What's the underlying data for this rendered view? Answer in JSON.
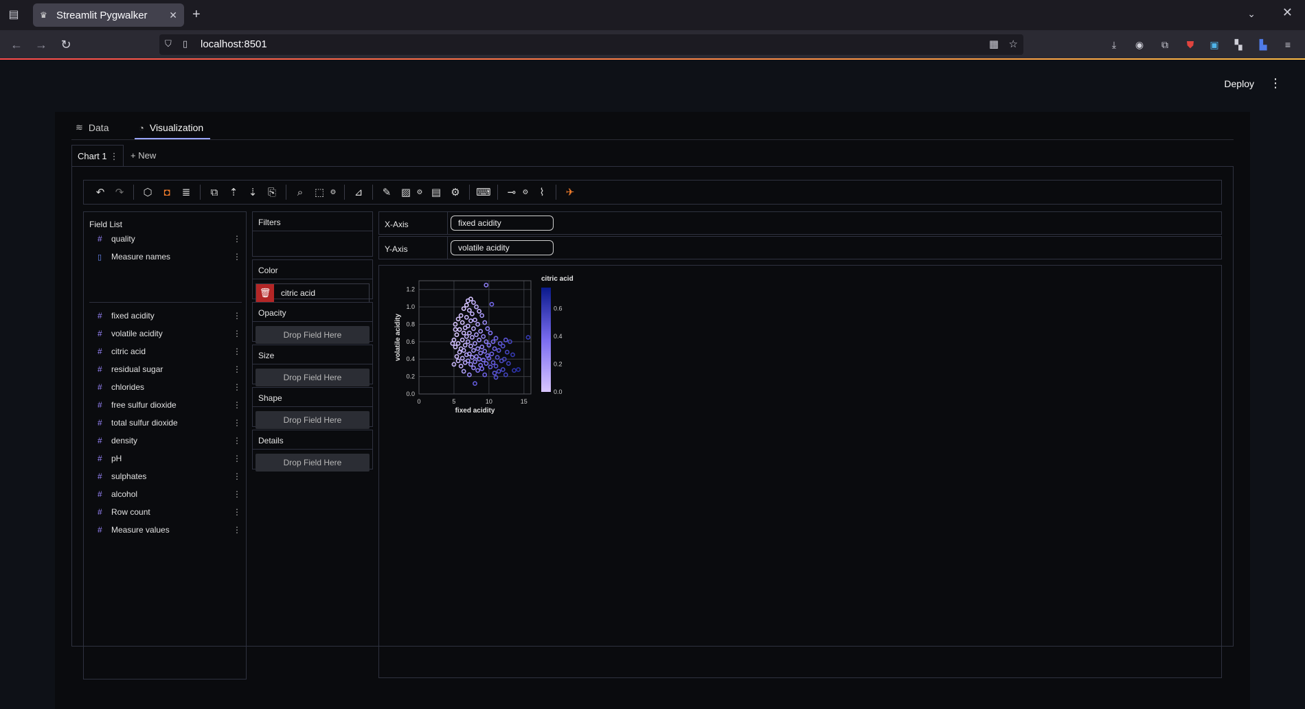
{
  "browser": {
    "tab_title": "Streamlit Pygwalker",
    "url": "localhost:8501"
  },
  "app": {
    "deploy_label": "Deploy",
    "tabs": [
      {
        "label": "Data",
        "icon": "database-icon"
      },
      {
        "label": "Visualization",
        "icon": "chart-icon"
      }
    ],
    "chart_tab": "Chart 1",
    "new_chart": "+ New"
  },
  "field_list": {
    "title": "Field List",
    "dimensions": [
      {
        "label": "quality",
        "type": "measure"
      },
      {
        "label": "Measure names",
        "type": "dimension"
      }
    ],
    "measures": [
      "fixed acidity",
      "volatile acidity",
      "citric acid",
      "residual sugar",
      "chlorides",
      "free sulfur dioxide",
      "total sulfur dioxide",
      "density",
      "pH",
      "sulphates",
      "alcohol",
      "Row count",
      "Measure values"
    ]
  },
  "encodings": {
    "filters": "Filters",
    "color": "Color",
    "color_field": "citric acid",
    "opacity": "Opacity",
    "size": "Size",
    "shape": "Shape",
    "details": "Details",
    "drop_placeholder": "Drop Field Here"
  },
  "axes": {
    "x_label": "X-Axis",
    "x_field": "fixed acidity",
    "y_label": "Y-Axis",
    "y_field": "volatile acidity"
  },
  "colors": {
    "accent": "#9aa6ff",
    "delete": "#b32626",
    "legend_high": "#0a1a8c",
    "legend_low": "#d9c6ff"
  },
  "chart_data": {
    "type": "scatter",
    "xlabel": "fixed acidity",
    "ylabel": "volatile acidity",
    "legend_title": "citric acid",
    "xlim": [
      0,
      16
    ],
    "ylim": [
      0,
      1.3
    ],
    "x_ticks": [
      "0",
      "5",
      "10",
      "15"
    ],
    "y_ticks": [
      "0.0",
      "0.2",
      "0.4",
      "0.6",
      "0.8",
      "1.0",
      "1.2"
    ],
    "legend_ticks": [
      "0.6",
      "0.4",
      "0.2",
      "0.0"
    ],
    "legend_range": [
      0,
      0.75
    ],
    "points": [
      [
        9.6,
        1.25,
        0.3
      ],
      [
        10.4,
        1.03,
        0.4
      ],
      [
        15.6,
        0.65,
        0.6
      ],
      [
        7.4,
        1.09,
        0.0
      ],
      [
        7.0,
        1.07,
        0.05
      ],
      [
        7.8,
        1.05,
        0.1
      ],
      [
        6.8,
        1.02,
        0.0
      ],
      [
        8.2,
        1.0,
        0.1
      ],
      [
        6.4,
        0.98,
        0.0
      ],
      [
        7.2,
        0.96,
        0.05
      ],
      [
        8.6,
        0.95,
        0.1
      ],
      [
        7.6,
        0.92,
        0.08
      ],
      [
        6.0,
        0.9,
        0.02
      ],
      [
        9.0,
        0.9,
        0.2
      ],
      [
        6.8,
        0.88,
        0.05
      ],
      [
        5.6,
        0.86,
        0.0
      ],
      [
        8.0,
        0.85,
        0.12
      ],
      [
        7.4,
        0.84,
        0.1
      ],
      [
        6.2,
        0.82,
        0.02
      ],
      [
        9.4,
        0.82,
        0.25
      ],
      [
        5.2,
        0.8,
        0.0
      ],
      [
        8.4,
        0.8,
        0.15
      ],
      [
        7.0,
        0.78,
        0.08
      ],
      [
        6.6,
        0.76,
        0.05
      ],
      [
        7.8,
        0.75,
        0.12
      ],
      [
        9.8,
        0.75,
        0.3
      ],
      [
        5.8,
        0.74,
        0.02
      ],
      [
        8.8,
        0.72,
        0.2
      ],
      [
        6.4,
        0.7,
        0.05
      ],
      [
        7.2,
        0.7,
        0.1
      ],
      [
        10.2,
        0.7,
        0.35
      ],
      [
        5.4,
        0.68,
        0.0
      ],
      [
        8.2,
        0.68,
        0.18
      ],
      [
        6.8,
        0.66,
        0.08
      ],
      [
        9.2,
        0.66,
        0.28
      ],
      [
        7.6,
        0.65,
        0.15
      ],
      [
        11.0,
        0.64,
        0.42
      ],
      [
        12.4,
        0.62,
        0.48
      ],
      [
        5.0,
        0.62,
        0.02
      ],
      [
        6.2,
        0.62,
        0.05
      ],
      [
        8.6,
        0.62,
        0.22
      ],
      [
        10.6,
        0.6,
        0.38
      ],
      [
        7.0,
        0.6,
        0.12
      ],
      [
        13.0,
        0.6,
        0.55
      ],
      [
        9.6,
        0.6,
        0.3
      ],
      [
        5.6,
        0.58,
        0.04
      ],
      [
        8.0,
        0.58,
        0.2
      ],
      [
        11.6,
        0.58,
        0.45
      ],
      [
        6.6,
        0.56,
        0.08
      ],
      [
        10.0,
        0.56,
        0.35
      ],
      [
        7.4,
        0.55,
        0.15
      ],
      [
        12.0,
        0.55,
        0.5
      ],
      [
        9.0,
        0.54,
        0.28
      ],
      [
        5.2,
        0.54,
        0.02
      ],
      [
        8.4,
        0.52,
        0.25
      ],
      [
        6.0,
        0.52,
        0.05
      ],
      [
        10.8,
        0.52,
        0.42
      ],
      [
        7.8,
        0.5,
        0.2
      ],
      [
        11.4,
        0.5,
        0.48
      ],
      [
        6.4,
        0.5,
        0.1
      ],
      [
        9.4,
        0.49,
        0.32
      ],
      [
        12.6,
        0.48,
        0.55
      ],
      [
        5.8,
        0.48,
        0.06
      ],
      [
        8.8,
        0.47,
        0.3
      ],
      [
        7.2,
        0.46,
        0.18
      ],
      [
        10.4,
        0.46,
        0.42
      ],
      [
        6.8,
        0.45,
        0.15
      ],
      [
        13.4,
        0.45,
        0.6
      ],
      [
        9.8,
        0.44,
        0.38
      ],
      [
        8.2,
        0.43,
        0.28
      ],
      [
        5.4,
        0.43,
        0.04
      ],
      [
        11.2,
        0.42,
        0.5
      ],
      [
        7.6,
        0.42,
        0.22
      ],
      [
        10.0,
        0.41,
        0.4
      ],
      [
        6.2,
        0.41,
        0.1
      ],
      [
        8.6,
        0.4,
        0.32
      ],
      [
        12.2,
        0.4,
        0.55
      ],
      [
        9.2,
        0.39,
        0.36
      ],
      [
        7.0,
        0.38,
        0.2
      ],
      [
        11.8,
        0.38,
        0.52
      ],
      [
        5.6,
        0.38,
        0.06
      ],
      [
        8.0,
        0.37,
        0.3
      ],
      [
        10.6,
        0.36,
        0.45
      ],
      [
        6.6,
        0.36,
        0.14
      ],
      [
        9.6,
        0.35,
        0.4
      ],
      [
        12.8,
        0.35,
        0.58
      ],
      [
        7.4,
        0.34,
        0.24
      ],
      [
        8.8,
        0.33,
        0.35
      ],
      [
        11.0,
        0.32,
        0.5
      ],
      [
        6.0,
        0.32,
        0.1
      ],
      [
        10.2,
        0.31,
        0.44
      ],
      [
        7.8,
        0.3,
        0.28
      ],
      [
        9.0,
        0.29,
        0.38
      ],
      [
        12.0,
        0.28,
        0.55
      ],
      [
        8.4,
        0.27,
        0.34
      ],
      [
        13.6,
        0.27,
        0.62
      ],
      [
        6.4,
        0.26,
        0.16
      ],
      [
        11.4,
        0.26,
        0.52
      ],
      [
        10.8,
        0.24,
        0.48
      ],
      [
        9.4,
        0.22,
        0.42
      ],
      [
        12.4,
        0.22,
        0.56
      ],
      [
        7.2,
        0.22,
        0.26
      ],
      [
        11.0,
        0.19,
        0.5
      ],
      [
        8.0,
        0.12,
        0.45
      ],
      [
        14.2,
        0.28,
        0.66
      ],
      [
        5.0,
        0.34,
        0.06
      ],
      [
        4.8,
        0.58,
        0.04
      ],
      [
        5.2,
        0.74,
        0.02
      ]
    ]
  }
}
